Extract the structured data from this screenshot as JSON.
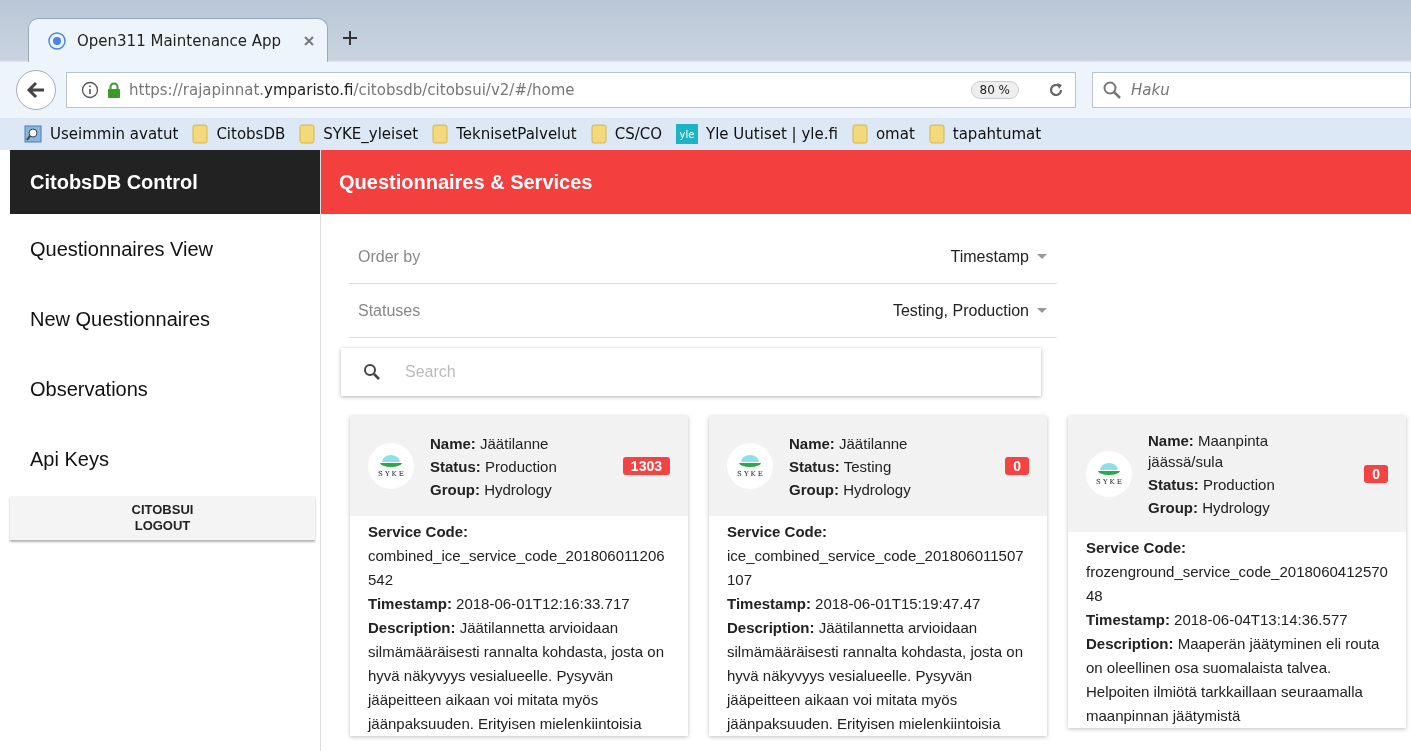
{
  "browser": {
    "tab": {
      "title": "Open311 Maintenance App"
    },
    "url": {
      "scheme": "https://rajapinnat.",
      "host": "ymparisto.fi",
      "path": "/citobsdb/citobsui/v2/#/home"
    },
    "zoom": "80 %",
    "search_placeholder": "Haku",
    "bookmarks": [
      {
        "kind": "history",
        "label": "Useimmin avatut"
      },
      {
        "kind": "folder",
        "label": "CitobsDB"
      },
      {
        "kind": "folder",
        "label": "SYKE_yleiset"
      },
      {
        "kind": "folder",
        "label": "TeknisetPalvelut"
      },
      {
        "kind": "folder",
        "label": "CS/CO"
      },
      {
        "kind": "site",
        "label": "Yle Uutiset | yle.fi",
        "badge": "yle"
      },
      {
        "kind": "folder",
        "label": "omat"
      },
      {
        "kind": "folder",
        "label": "tapahtumat"
      }
    ]
  },
  "sidebar": {
    "title": "CitobsDB Control",
    "items": [
      "Questionnaires View",
      "New Questionnaires",
      "Observations",
      "Api Keys"
    ],
    "logout": "CITOBSUI LOGOUT"
  },
  "header": {
    "title": "Questionnaires & Services"
  },
  "filters": [
    {
      "label": "Order by",
      "value": "Timestamp"
    },
    {
      "label": "Statuses",
      "value": "Testing, Production"
    }
  ],
  "search": {
    "placeholder": "Search"
  },
  "cards": [
    {
      "logo": "SYKE",
      "header": [
        "**Name:** Jäätilanne",
        "**Status:** Production",
        "**Group:** Hydrology"
      ],
      "count": "1303",
      "service_code_label": "Service Code:",
      "service_code": "combined_ice_service_code_201806011206542",
      "timestamp": "**Timestamp:** 2018-06-01T12:16:33.717",
      "description": "**Description:** Jäätilannetta arvioidaan silmämääräisesti rannalta kohdasta, josta on hyvä näkyvyys vesialueelle. Pysyvän jääpeitteen aikaan voi mitata myös jäänpaksuuden. Erityisen mielenkiintoisia"
    },
    {
      "logo": "SYKE",
      "header": [
        "**Name:** Jäätilanne",
        "**Status:** Testing",
        "**Group:** Hydrology"
      ],
      "count": "0",
      "service_code_label": "Service Code:",
      "service_code": "ice_combined_service_code_201806011507107",
      "timestamp": "**Timestamp:** 2018-06-01T15:19:47.47",
      "description": "**Description:** Jäätilannetta arvioidaan silmämääräisesti rannalta kohdasta, josta on hyvä näkyvyys vesialueelle. Pysyvän jääpeitteen aikaan voi mitata myös jäänpaksuuden. Erityisen mielenkiintoisia"
    },
    {
      "logo": "SYKE",
      "header": [
        "**Name:** Maanpinta jäässä/sula",
        "**Status:** Production",
        "**Group:** Hydrology"
      ],
      "count": "0",
      "service_code_label": "Service Code:",
      "service_code": "frozenground_service_code_201806041257048",
      "timestamp": "**Timestamp:** 2018-06-04T13:14:36.577",
      "description": "**Description:** Maaperän jäätyminen eli routa on oleellinen osa suomalaista talvea. Helpoiten ilmiötä tarkkaillaan seuraamalla maanpinnan jäätymistä"
    }
  ]
}
